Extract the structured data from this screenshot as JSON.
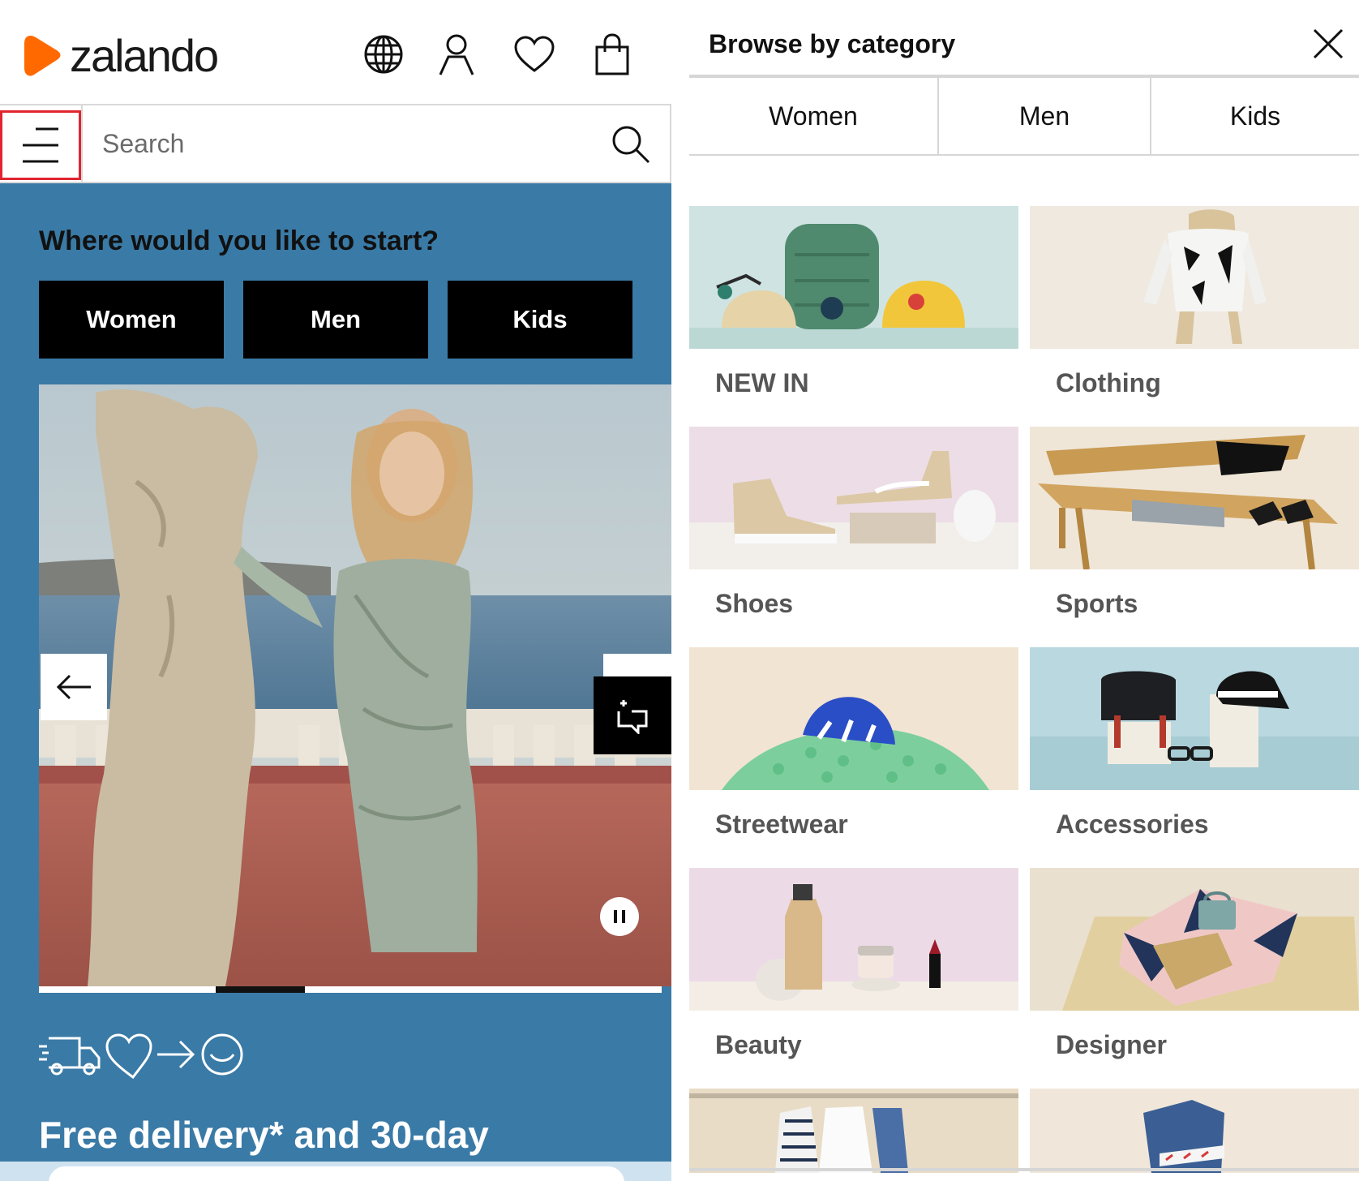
{
  "header": {
    "logo_text": "zalando",
    "brand_color": "#ff6900",
    "icons": [
      "globe-icon",
      "user-icon",
      "heart-icon",
      "bag-icon"
    ]
  },
  "search": {
    "placeholder": "Search"
  },
  "promo": {
    "heading": "Where would you like to start?",
    "buttons": [
      "Women",
      "Men",
      "Kids"
    ],
    "background_color": "#3a7aa6",
    "usp_text": "Free delivery* and 30-day"
  },
  "category_panel": {
    "title": "Browse by category",
    "tabs": [
      "Women",
      "Men",
      "Kids"
    ],
    "categories": [
      {
        "label": "NEW IN"
      },
      {
        "label": "Clothing"
      },
      {
        "label": "Shoes"
      },
      {
        "label": "Sports"
      },
      {
        "label": "Streetwear"
      },
      {
        "label": "Accessories"
      },
      {
        "label": "Beauty"
      },
      {
        "label": "Designer"
      }
    ]
  }
}
